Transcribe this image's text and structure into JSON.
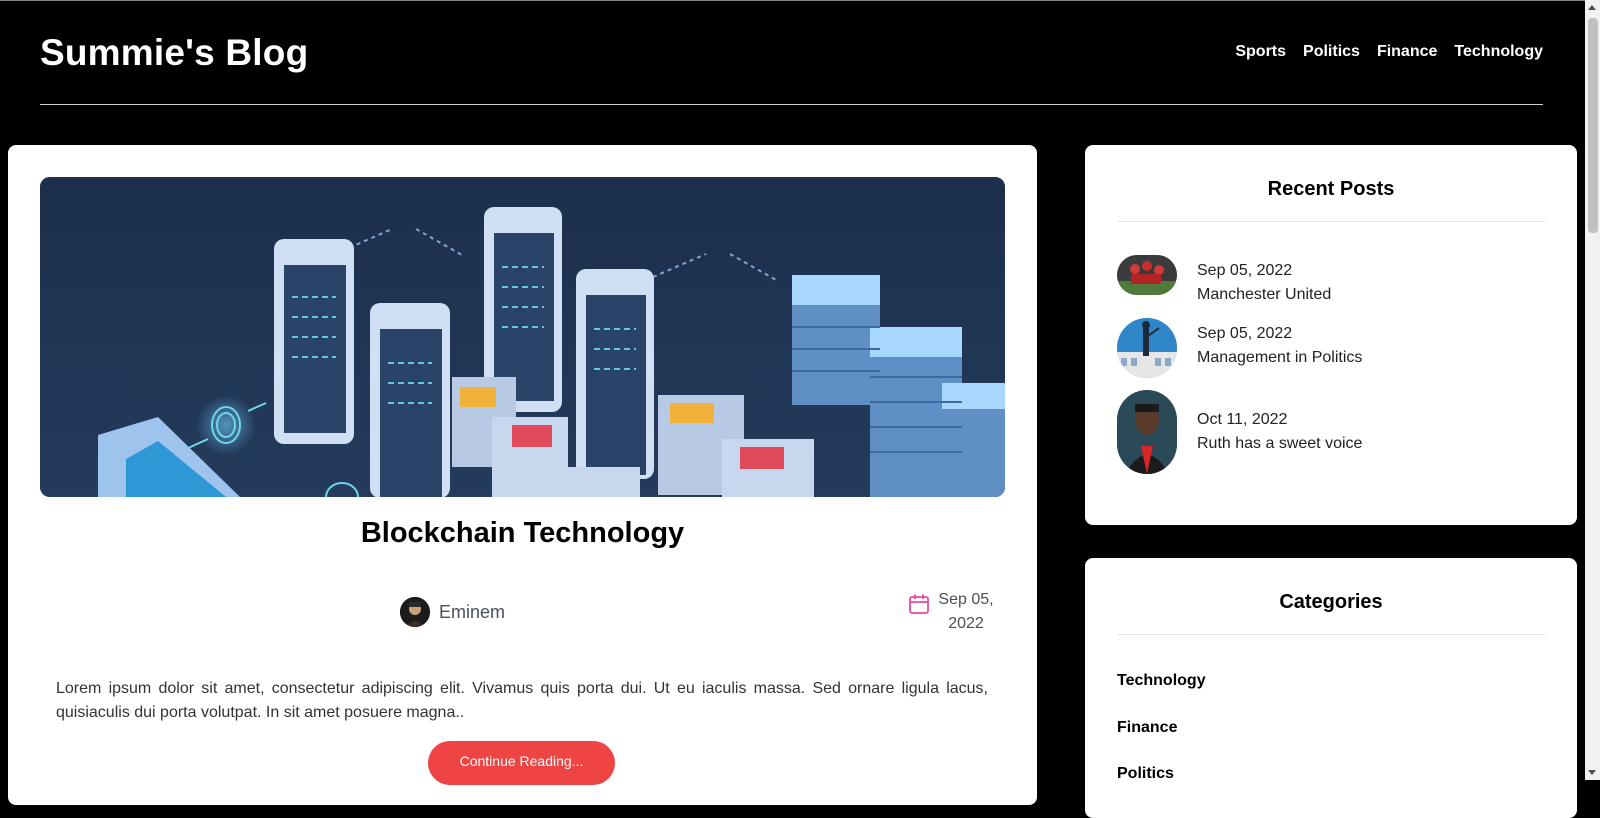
{
  "site": {
    "title": "Summie's Blog"
  },
  "nav": {
    "items": [
      {
        "label": "Sports"
      },
      {
        "label": "Politics"
      },
      {
        "label": "Finance"
      },
      {
        "label": "Technology"
      }
    ]
  },
  "post": {
    "title": "Blockchain Technology",
    "author": "Eminem",
    "date": "Sep 05, 2022",
    "excerpt": "Lorem ipsum dolor sit amet, consectetur adipiscing elit. Vivamus quis porta dui. Ut eu iaculis massa. Sed ornare ligula lacus, quisiaculis dui porta volutpat. In sit amet posuere magna..",
    "continue_label": "Continue Reading..."
  },
  "recent_posts": {
    "title": "Recent Posts",
    "items": [
      {
        "date": "Sep 05, 2022",
        "title": "Manchester United"
      },
      {
        "date": "Sep 05, 2022",
        "title": "Management in Politics"
      },
      {
        "date": "Oct 11, 2022",
        "title": "Ruth has a sweet voice"
      }
    ]
  },
  "categories": {
    "title": "Categories",
    "items": [
      {
        "label": "Technology"
      },
      {
        "label": "Finance"
      },
      {
        "label": "Politics"
      }
    ]
  },
  "colors": {
    "background": "#000000",
    "card": "#ffffff",
    "accent_button": "#ef4444",
    "calendar_icon": "#ec4899"
  },
  "icons": {
    "date": "calendar-icon"
  }
}
